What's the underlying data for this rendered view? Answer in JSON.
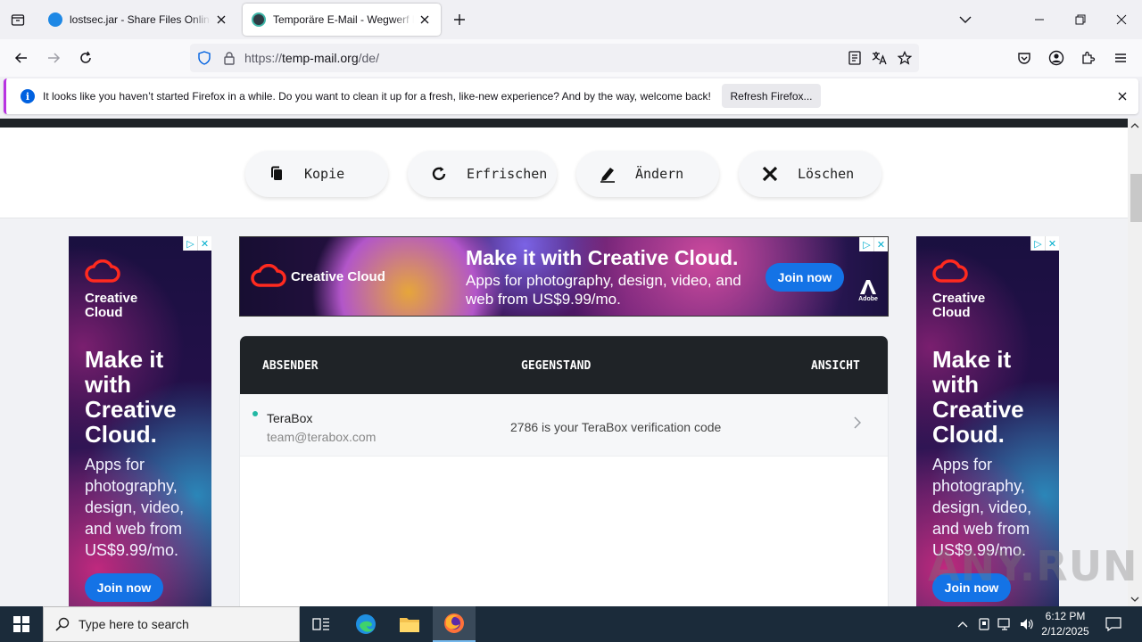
{
  "browser": {
    "tabs": [
      {
        "title": "lostsec.jar - Share Files Online & Se",
        "active": false
      },
      {
        "title": "Temporäre E-Mail - Wegwerf Einweg",
        "active": true
      }
    ],
    "url_prefix": "https://",
    "url_host": "temp-mail.org",
    "url_path": "/de/"
  },
  "notification": {
    "message": "It looks like you haven’t started Firefox in a while. Do you want to clean it up for a fresh, like-new experience? And by the way, welcome back!",
    "button": "Refresh Firefox..."
  },
  "actions": [
    {
      "label": "Kopie",
      "icon": "copy-icon"
    },
    {
      "label": "Erfrischen",
      "icon": "refresh-icon"
    },
    {
      "label": "Ändern",
      "icon": "edit-icon"
    },
    {
      "label": "Löschen",
      "icon": "delete-icon"
    }
  ],
  "ads": {
    "side": {
      "brand": "Creative Cloud",
      "headline": "Make it with Creative Cloud.",
      "body": "Apps for photography, design, video, and web from US$9.99/mo.",
      "cta": "Join now"
    },
    "banner": {
      "brand": "Creative Cloud",
      "headline": "Make it with Creative Cloud.",
      "body": "Apps for photography, design, video, and web from US$9.99/mo.",
      "cta": "Join now",
      "adobe": "Adobe"
    }
  },
  "inbox": {
    "columns": {
      "sender": "ABSENDER",
      "subject": "GEGENSTAND",
      "view": "ANSICHT"
    },
    "messages": [
      {
        "sender_name": "TeraBox",
        "sender_email": "team@terabox.com",
        "subject": "2786 is your TeraBox verification code"
      }
    ]
  },
  "watermark": "ANY.RUN",
  "taskbar": {
    "search_placeholder": "Type here to search",
    "time": "6:12 PM",
    "date": "2/12/2025"
  }
}
